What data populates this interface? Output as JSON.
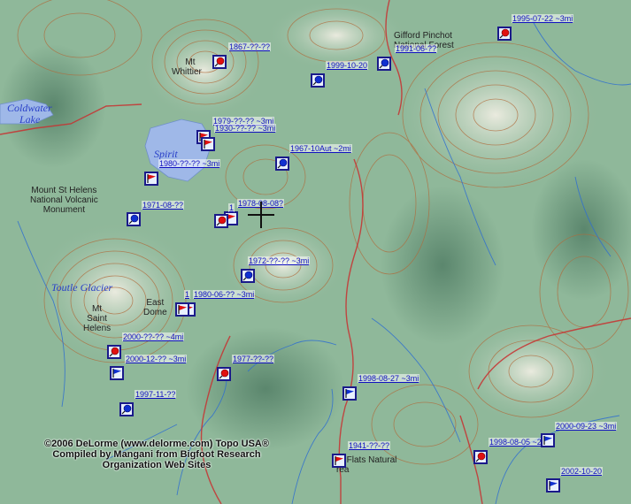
{
  "map": {
    "place_labels": [
      {
        "id": "mt-whittier",
        "lines": [
          "Mt",
          "Whittier"
        ]
      },
      {
        "id": "gifford-pinchot",
        "lines": [
          "Gifford Pinchot",
          "National Forest"
        ]
      },
      {
        "id": "mt-st-helens-nvm",
        "lines": [
          "Mount St Helens",
          "National Volcanic",
          "Monument"
        ]
      },
      {
        "id": "east-dome",
        "lines": [
          "East",
          "Dome"
        ]
      },
      {
        "id": "mt-saint-helens",
        "lines": [
          "Mt",
          "Saint",
          "Helens"
        ]
      },
      {
        "id": "flats-natural-area",
        "lines": [
          "ar Flats Natural",
          "rea"
        ]
      }
    ],
    "water_labels": [
      {
        "id": "coldwater-lake",
        "lines": [
          "Coldwater",
          "Lake"
        ]
      },
      {
        "id": "spirit-lake",
        "lines": [
          "Spirit"
        ]
      },
      {
        "id": "toutle-glacier",
        "lines": [
          "Toutle Glacier"
        ]
      }
    ],
    "sightings": [
      {
        "id": "s1",
        "label": "1995-07-22 ~3mi",
        "icon": "red-flag-pin"
      },
      {
        "id": "s2",
        "label": "1991-06-??",
        "icon": "blue-pin"
      },
      {
        "id": "s3",
        "label": "1867-??-??",
        "icon": "red-pin"
      },
      {
        "id": "s4",
        "label": "1999-10-20",
        "icon": "blue-pin"
      },
      {
        "id": "s5",
        "label": "1979-??-?? ~3mi",
        "icon": "red-flag"
      },
      {
        "id": "s6",
        "label": "1930-??-?? ~3mi",
        "icon": "red-flag"
      },
      {
        "id": "s7",
        "label": "1967-10Aut ~2mi",
        "icon": "blue-pin"
      },
      {
        "id": "s8",
        "label": "1980-??-?? ~3mi",
        "icon": "red-flag"
      },
      {
        "id": "s9",
        "label": "1971-08-??",
        "icon": "blue-pin"
      },
      {
        "id": "s10",
        "label": "1978-08-08?",
        "icon": "red-flag"
      },
      {
        "id": "s11",
        "label": "1",
        "icon": "red-pin"
      },
      {
        "id": "s12",
        "label": "1972-??-?? ~3mi",
        "icon": "blue-pin"
      },
      {
        "id": "s13",
        "label": "1980-06-?? ~3mi",
        "icon": "red-flag"
      },
      {
        "id": "s14",
        "label": "1",
        "icon": "red-flag"
      },
      {
        "id": "s15",
        "label": "2000-??-?? ~4mi",
        "icon": "red-pin"
      },
      {
        "id": "s16",
        "label": "2000-12-?? ~3mi",
        "icon": "blue-flag"
      },
      {
        "id": "s17",
        "label": "1977-??-??",
        "icon": "red-pin"
      },
      {
        "id": "s18",
        "label": "1997-11-??",
        "icon": "blue-pin"
      },
      {
        "id": "s19",
        "label": "1998-08-27 ~3mi",
        "icon": "blue-flag"
      },
      {
        "id": "s20",
        "label": "1941-??-??",
        "icon": "red-flag"
      },
      {
        "id": "s21",
        "label": "1998-08-05 ~2mi",
        "icon": "red-pin"
      },
      {
        "id": "s22",
        "label": "2000-09-23 ~3mi",
        "icon": "blue-flag"
      },
      {
        "id": "s23",
        "label": "2002-10-20",
        "icon": "blue-flag"
      }
    ],
    "credit": {
      "line1": "©2006 DeLorme (www.delorme.com) Topo USA®",
      "line2": "Compiled by Mangani from Bigfoot Research",
      "line3": "Organization Web Sites"
    },
    "colors": {
      "terrain": "#8fb89a",
      "contour": "#b06a3a",
      "road": "#c83030",
      "stream": "#2f6fd0",
      "lake": "#9fb8e8",
      "marker_border": "#1a1a8a",
      "red_marker": "#e01010",
      "blue_marker": "#1030d0"
    }
  }
}
